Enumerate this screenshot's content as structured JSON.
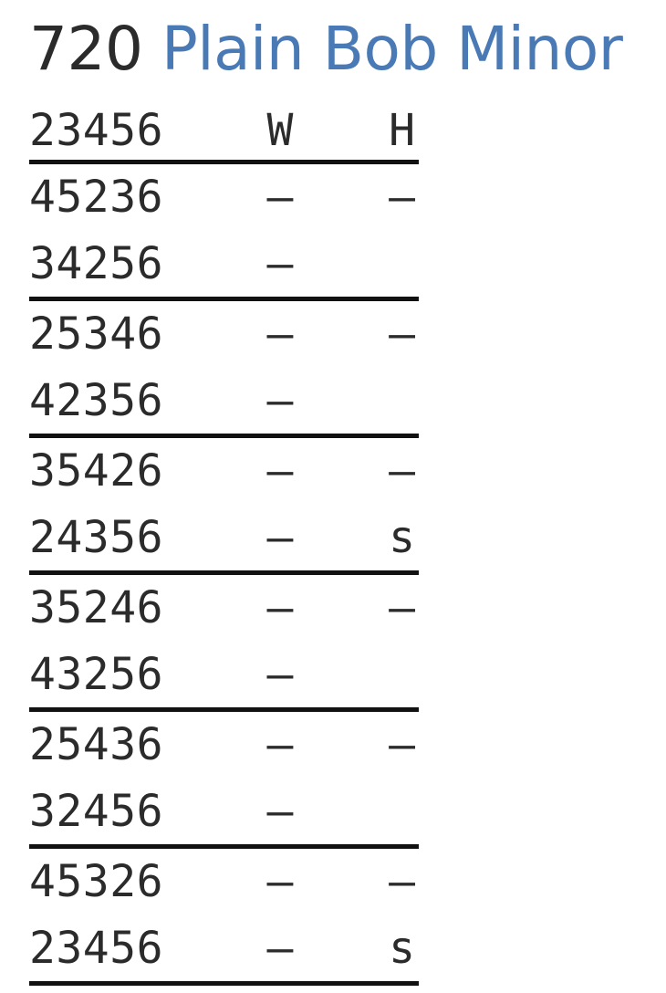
{
  "title": {
    "count": "720",
    "method": "Plain Bob Minor"
  },
  "composition": {
    "columns": {
      "change": "23456",
      "w": "W",
      "h": "H"
    },
    "blocks": [
      {
        "rows": [
          {
            "change": "45236",
            "w": "–",
            "h": "–"
          },
          {
            "change": "34256",
            "w": "–",
            "h": ""
          }
        ]
      },
      {
        "rows": [
          {
            "change": "25346",
            "w": "–",
            "h": "–"
          },
          {
            "change": "42356",
            "w": "–",
            "h": ""
          }
        ]
      },
      {
        "rows": [
          {
            "change": "35426",
            "w": "–",
            "h": "–"
          },
          {
            "change": "24356",
            "w": "–",
            "h": "s"
          }
        ]
      },
      {
        "rows": [
          {
            "change": "35246",
            "w": "–",
            "h": "–"
          },
          {
            "change": "43256",
            "w": "–",
            "h": ""
          }
        ]
      },
      {
        "rows": [
          {
            "change": "25436",
            "w": "–",
            "h": "–"
          },
          {
            "change": "32456",
            "w": "–",
            "h": ""
          }
        ]
      },
      {
        "rows": [
          {
            "change": "45326",
            "w": "–",
            "h": "–"
          },
          {
            "change": "23456",
            "w": "–",
            "h": "s"
          }
        ]
      }
    ]
  }
}
